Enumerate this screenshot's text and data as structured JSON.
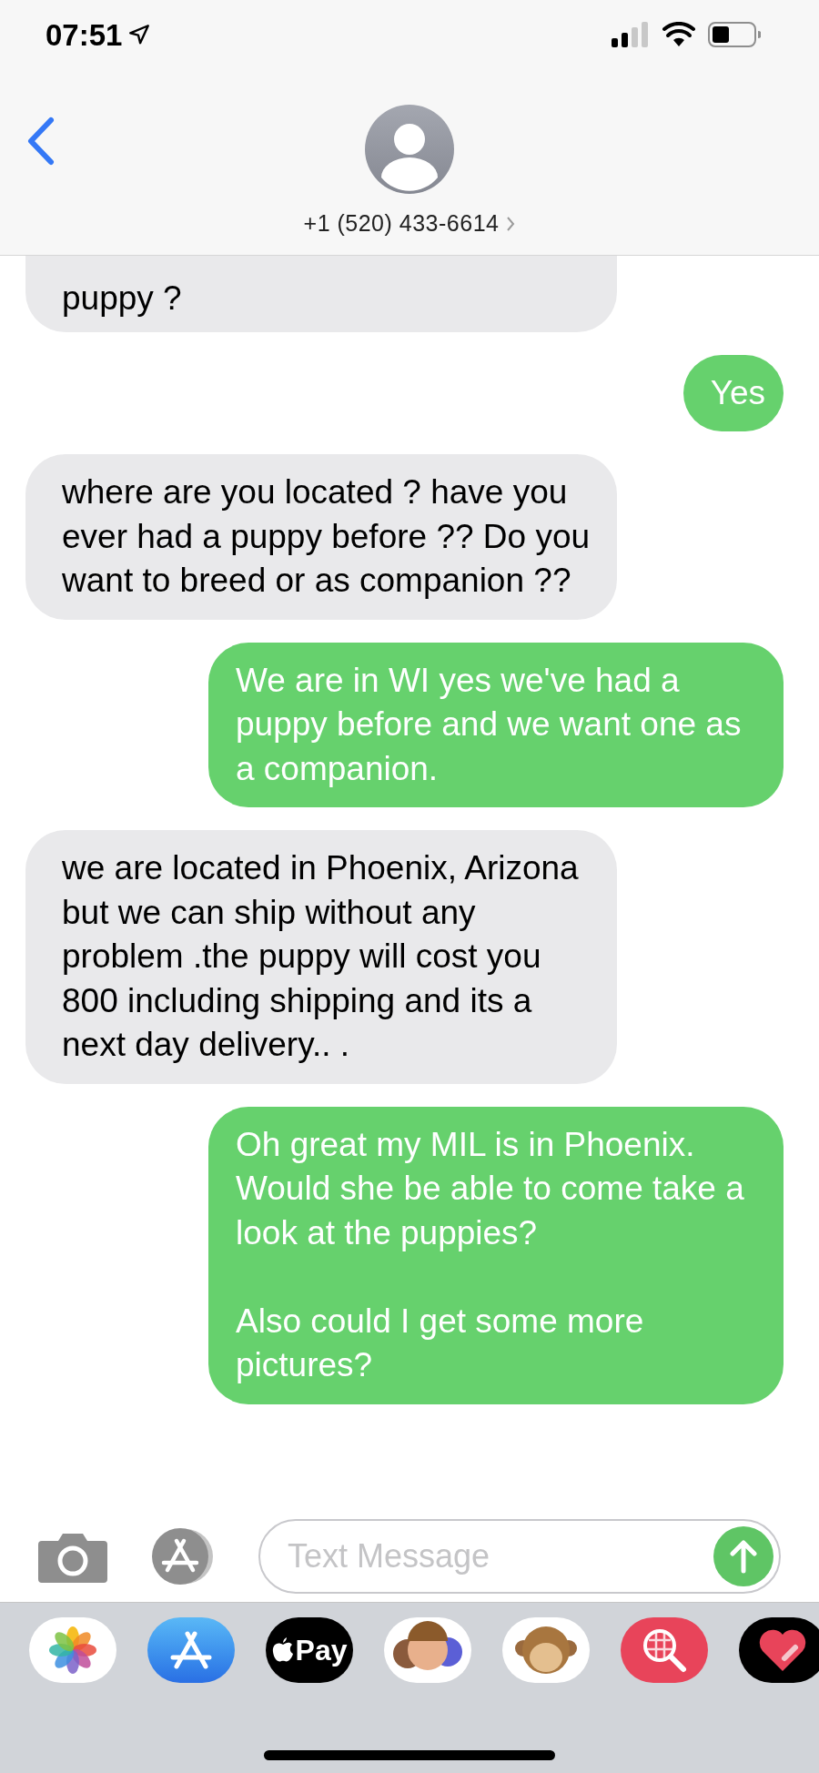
{
  "status_bar": {
    "time": "07:51"
  },
  "header": {
    "contact": "+1 (520) 433-6614"
  },
  "messages": [
    {
      "kind": "incoming",
      "text": "puppy ?"
    },
    {
      "kind": "outgoing",
      "text": "Yes"
    },
    {
      "kind": "incoming",
      "text": "where are you located ? have you ever had a puppy before ?? Do you want to breed or as companion ??"
    },
    {
      "kind": "outgoing",
      "text": "We are in WI yes we've had a puppy before and we want one as a companion."
    },
    {
      "kind": "incoming",
      "text": "we are located in Phoenix, Arizona but we can ship without any problem .the puppy will cost you 800 including shipping and its a next day delivery.. ."
    },
    {
      "kind": "outgoing",
      "text": "Oh great my MIL is in Phoenix. Would she be able to come take a look at the puppies?\n\nAlso could I get some more pictures?"
    }
  ],
  "composer": {
    "placeholder": "Text Message"
  },
  "app_drawer": [
    {
      "kind": "photos"
    },
    {
      "kind": "appstore"
    },
    {
      "kind": "applepay",
      "label": "Pay"
    },
    {
      "kind": "memoji"
    },
    {
      "kind": "animoji"
    },
    {
      "kind": "images"
    },
    {
      "kind": "touch"
    }
  ]
}
